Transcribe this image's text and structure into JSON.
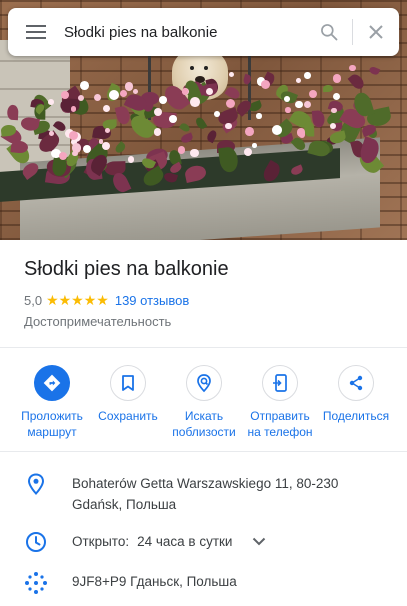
{
  "search": {
    "value": "Słodki pies na balkonie",
    "placeholder": "Поиск на Google Картах"
  },
  "place": {
    "name": "Słodki pies na balkonie",
    "rating": "5,0",
    "stars": "★★★★★",
    "reviews": "139 отзывов",
    "category": "Достопримечательность"
  },
  "actions": [
    {
      "label_line1": "Проложить",
      "label_line2": "маршрут",
      "icon": "directions-icon"
    },
    {
      "label_line1": "Сохранить",
      "label_line2": "",
      "icon": "bookmark-icon"
    },
    {
      "label_line1": "Искать",
      "label_line2": "поблизости",
      "icon": "nearby-icon"
    },
    {
      "label_line1": "Отправить",
      "label_line2": "на телефон",
      "icon": "send-to-phone-icon"
    },
    {
      "label_line1": "Поделиться",
      "label_line2": "",
      "icon": "share-icon"
    }
  ],
  "details": {
    "address_line1": "Bohaterów Getta Warszawskiego 11, 80-230",
    "address_line2": "Gdańsk, Польша",
    "hours_status": "Открыто:",
    "hours_value": "24 часа в сутки",
    "plus_code": "9JF8+P9 Гданьск, Польша"
  },
  "colors": {
    "accent": "#1a73e8",
    "star": "#fbbc04",
    "text_secondary": "#70757a"
  }
}
